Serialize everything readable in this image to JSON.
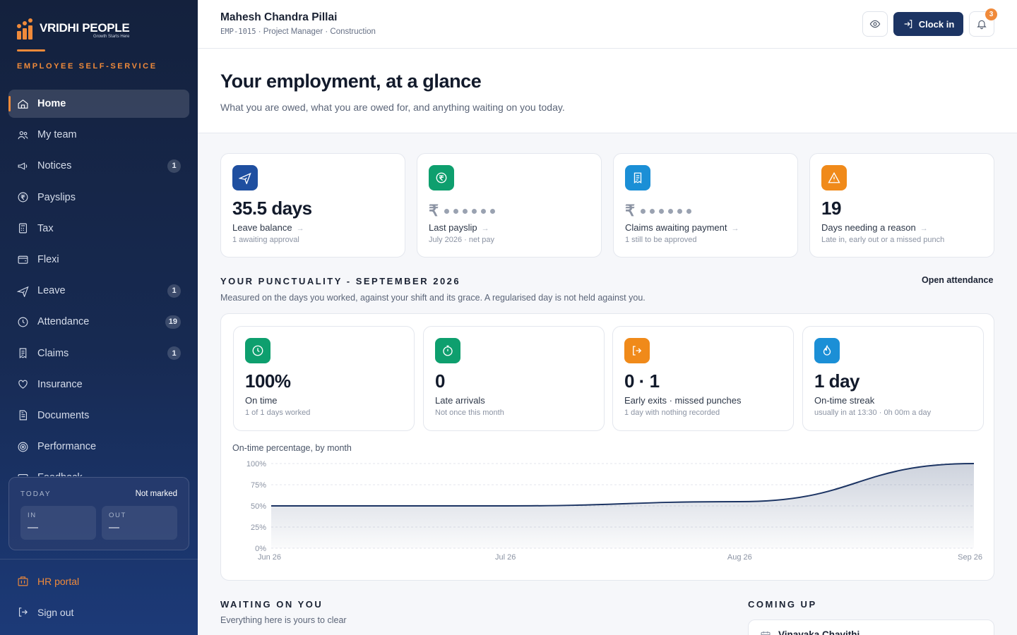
{
  "brand": {
    "name": "VRIDHI PEOPLE",
    "tagline": "Growth Starts Here",
    "section": "EMPLOYEE SELF-SERVICE",
    "accent": "#f08a3a",
    "navy": "#1c3463"
  },
  "nav": [
    {
      "label": "Home",
      "icon": "home-icon",
      "badge": "",
      "active": true
    },
    {
      "label": "My team",
      "icon": "team-icon",
      "badge": ""
    },
    {
      "label": "Notices",
      "icon": "megaphone-icon",
      "badge": "1"
    },
    {
      "label": "Payslips",
      "icon": "rupee-circle-icon",
      "badge": ""
    },
    {
      "label": "Tax",
      "icon": "calculator-icon",
      "badge": ""
    },
    {
      "label": "Flexi",
      "icon": "wallet-icon",
      "badge": ""
    },
    {
      "label": "Leave",
      "icon": "plane-icon",
      "badge": "1"
    },
    {
      "label": "Attendance",
      "icon": "clock-icon",
      "badge": "19"
    },
    {
      "label": "Claims",
      "icon": "receipt-icon",
      "badge": "1"
    },
    {
      "label": "Insurance",
      "icon": "heart-icon",
      "badge": ""
    },
    {
      "label": "Documents",
      "icon": "document-icon",
      "badge": ""
    },
    {
      "label": "Performance",
      "icon": "target-icon",
      "badge": ""
    },
    {
      "label": "Feedback",
      "icon": "message-icon",
      "badge": ""
    }
  ],
  "today": {
    "title": "TODAY",
    "status": "Not marked",
    "in_label": "IN",
    "in_value": "—",
    "out_label": "OUT",
    "out_value": "—"
  },
  "footer_links": {
    "hr_portal": "HR portal",
    "sign_out": "Sign out"
  },
  "user": {
    "name": "Mahesh Chandra Pillai",
    "emp_id": "EMP-1015",
    "meta": " · Project Manager · Construction"
  },
  "topbar": {
    "clock_in": "Clock in",
    "notifications": "3"
  },
  "hero": {
    "title": "Your employment, at a glance",
    "subtitle": "What you are owed, what you are owed for, and anything waiting on you today."
  },
  "tiles": [
    {
      "value": "35.5 days",
      "label": "Leave balance",
      "sub": "1 awaiting approval",
      "icon": "plane-icon",
      "color": "#1f4fa0"
    },
    {
      "value": "",
      "masked": true,
      "label": "Last payslip",
      "sub": "July 2026 · net pay",
      "icon": "rupee-circle-icon",
      "color": "#0e9f6e"
    },
    {
      "value": "",
      "masked": true,
      "label": "Claims awaiting payment",
      "sub": "1 still to be approved",
      "icon": "receipt-icon",
      "color": "#1b8fd6"
    },
    {
      "value": "19",
      "label": "Days needing a reason",
      "sub": "Late in, early out or a missed punch",
      "icon": "warning-icon",
      "color": "#f08a1a"
    }
  ],
  "currency_symbol": "₹",
  "punctuality": {
    "title": "YOUR PUNCTUALITY - SEPTEMBER 2026",
    "subtitle": "Measured on the days you worked, against your shift and its grace. A regularised day is not held against you.",
    "link": "Open attendance",
    "stats": [
      {
        "value": "100%",
        "label": "On time",
        "sub": "1 of 1 days worked",
        "icon": "clock-icon",
        "color": "#0e9f6e"
      },
      {
        "value": "0",
        "label": "Late arrivals",
        "sub": "Not once this month",
        "icon": "stopwatch-icon",
        "color": "#0e9f6e"
      },
      {
        "value": "0 · 1",
        "label": "Early exits · missed punches",
        "sub": "1 day with nothing recorded",
        "icon": "exit-icon",
        "color": "#f08a1a"
      },
      {
        "value": "1 day",
        "label": "On-time streak",
        "sub": "usually in at 13:30 · 0h 00m a day",
        "icon": "flame-icon",
        "color": "#1b8fd6"
      }
    ],
    "chart_title": "On-time percentage, by month"
  },
  "chart_data": {
    "type": "area",
    "x": [
      "Jun 26",
      "Jul 26",
      "Aug 26",
      "Sep 26"
    ],
    "series": [
      {
        "values": [
          50,
          50,
          55,
          100
        ]
      }
    ],
    "ylim": [
      0,
      100
    ],
    "yticks": [
      "0%",
      "25%",
      "50%",
      "75%",
      "100%"
    ],
    "grid": true
  },
  "waiting": {
    "title": "WAITING ON YOU",
    "subtitle": "Everything here is yours to clear"
  },
  "coming_up": {
    "title": "COMING UP",
    "first_event": "Vinayaka Chavithi"
  }
}
